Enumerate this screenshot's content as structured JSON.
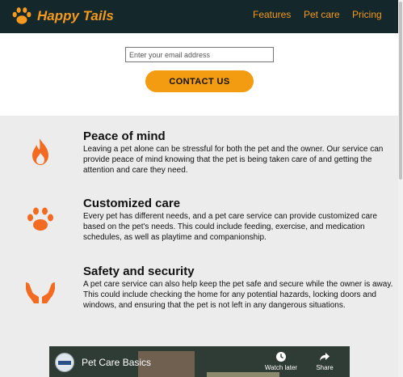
{
  "brand": {
    "name": "Happy Tails",
    "accent": "#f49a1e",
    "nav_bg": "#14272a"
  },
  "nav": {
    "items": [
      "Features",
      "Pet care",
      "Pricing"
    ]
  },
  "contact": {
    "email_placeholder": "Enter your email address",
    "button_label": "CONTACT US"
  },
  "features": [
    {
      "icon": "flame-icon",
      "title": "Peace of mind",
      "text": "Leaving a pet alone can be stressful for both the pet and the owner. Our service can provide peace of mind knowing that the pet is being taken care of and getting the attention and care they need."
    },
    {
      "icon": "paw-icon",
      "title": "Customized care",
      "text": "Every pet has different needs, and a pet care service can provide customized care based on the pet's needs. This could include feeding, exercise, and medication schedules, as well as playtime and companionship."
    },
    {
      "icon": "caring-hands-icon",
      "title": "Safety and security",
      "text": "A pet care service can also help keep the pet safe and secure while the owner is away. This could include checking the home for any potential hazards, locking doors and windows, and ensuring that the pet is not left in any dangerous situations."
    }
  ],
  "video": {
    "title": "Pet Care Basics",
    "watch_later": "Watch later",
    "share": "Share"
  }
}
